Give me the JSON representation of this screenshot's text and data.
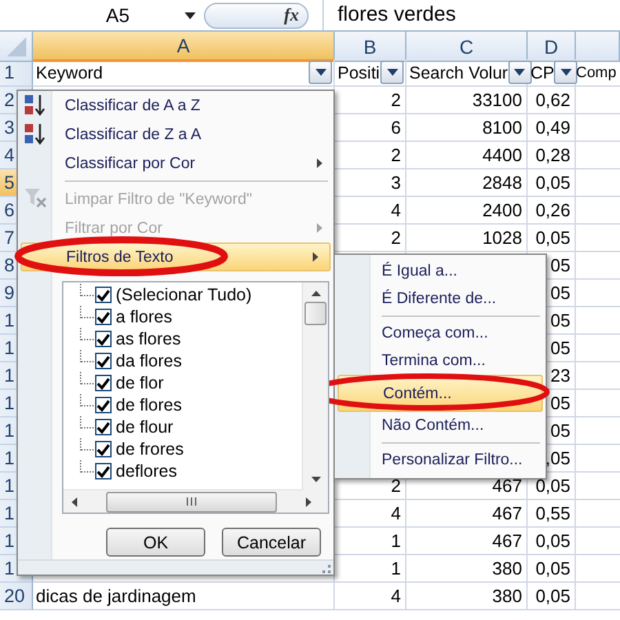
{
  "formula_bar": {
    "name_box": "A5",
    "function_button": "fx",
    "content": "flores verdes"
  },
  "columns": [
    {
      "label": "A",
      "selected": true
    },
    {
      "label": "B",
      "selected": false
    },
    {
      "label": "C",
      "selected": false
    },
    {
      "label": "D",
      "selected": false
    }
  ],
  "header_row": {
    "number": "1",
    "selected": false,
    "cells": [
      {
        "text": "Keyword",
        "filter": true
      },
      {
        "text": "Positi",
        "filter": true
      },
      {
        "text": "Search Volur",
        "filter": true
      },
      {
        "text": "CP",
        "filter": true
      },
      {
        "text": "Comp",
        "filter": false
      }
    ]
  },
  "rows": [
    {
      "number": "2",
      "selected": false,
      "b": "2",
      "c": "33100",
      "d": "0,62"
    },
    {
      "number": "3",
      "selected": false,
      "b": "6",
      "c": "8100",
      "d": "0,49"
    },
    {
      "number": "4",
      "selected": false,
      "b": "2",
      "c": "4400",
      "d": "0,28"
    },
    {
      "number": "5",
      "selected": true,
      "b": "3",
      "c": "2848",
      "d": "0,05"
    },
    {
      "number": "6",
      "selected": false,
      "b": "4",
      "c": "2400",
      "d": "0,26"
    },
    {
      "number": "7",
      "selected": false,
      "b": "2",
      "c": "1028",
      "d": "0,05"
    },
    {
      "number": "8",
      "selected": false,
      "d": "05"
    },
    {
      "number": "9",
      "selected": false,
      "d": "05"
    },
    {
      "number": "1",
      "selected": false,
      "d": "05"
    },
    {
      "number": "1",
      "selected": false,
      "d": "05"
    },
    {
      "number": "1",
      "selected": false,
      "d": "23"
    },
    {
      "number": "1",
      "selected": false,
      "d": "05"
    },
    {
      "number": "1",
      "selected": false,
      "d": "05"
    },
    {
      "number": "1",
      "selected": false,
      "d": ",05"
    },
    {
      "number": "1",
      "selected": false,
      "b": "2",
      "c": "467",
      "d": "0,05"
    },
    {
      "number": "1",
      "selected": false,
      "b": "4",
      "c": "467",
      "d": "0,55"
    },
    {
      "number": "1",
      "selected": false,
      "b": "1",
      "c": "467",
      "d": "0,05"
    },
    {
      "number": "1",
      "selected": false,
      "b": "1",
      "c": "380",
      "d": "0,05"
    },
    {
      "number": "20",
      "selected": false,
      "a": "dicas de jardinagem",
      "b": "4",
      "c": "380",
      "d": "0,05"
    }
  ],
  "filter_menu": {
    "items": [
      {
        "kind": "command",
        "label": "Classificar de A a Z",
        "disabled": false,
        "has_submenu": false,
        "selected": false
      },
      {
        "kind": "command",
        "label": "Classificar de Z a A",
        "disabled": false,
        "has_submenu": false,
        "selected": false
      },
      {
        "kind": "command",
        "label": "Classificar por Cor",
        "disabled": false,
        "has_submenu": true,
        "selected": false
      },
      {
        "kind": "separator"
      },
      {
        "kind": "command",
        "label": "Limpar Filtro de \"Keyword\"",
        "disabled": true,
        "has_submenu": false,
        "selected": false
      },
      {
        "kind": "command",
        "label": "Filtrar por Cor",
        "disabled": true,
        "has_submenu": true,
        "selected": false
      },
      {
        "kind": "command",
        "label": "Filtros de Texto",
        "disabled": false,
        "has_submenu": true,
        "selected": true
      }
    ],
    "values": [
      {
        "label": "(Selecionar Tudo)",
        "checked": true
      },
      {
        "label": "a flores",
        "checked": true
      },
      {
        "label": "as flores",
        "checked": true
      },
      {
        "label": "da flores",
        "checked": true
      },
      {
        "label": "de flor",
        "checked": true
      },
      {
        "label": "de flores",
        "checked": true
      },
      {
        "label": "de flour",
        "checked": true
      },
      {
        "label": "de frores",
        "checked": true
      },
      {
        "label": "deflores",
        "checked": true
      }
    ],
    "buttons": [
      "OK",
      "Cancelar"
    ]
  },
  "text_filters_menu": {
    "items": [
      {
        "kind": "command",
        "label": "É Igual a...",
        "selected": false
      },
      {
        "kind": "command",
        "label": "É Diferente de...",
        "selected": false
      },
      {
        "kind": "separator"
      },
      {
        "kind": "command",
        "label": "Começa com...",
        "selected": false
      },
      {
        "kind": "command",
        "label": "Termina com...",
        "selected": false
      },
      {
        "kind": "command",
        "label": "Contém...",
        "selected": true
      },
      {
        "kind": "command",
        "label": "Não Contém...",
        "selected": false
      },
      {
        "kind": "separator"
      },
      {
        "kind": "command",
        "label": "Personalizar Filtro...",
        "selected": false
      }
    ]
  }
}
